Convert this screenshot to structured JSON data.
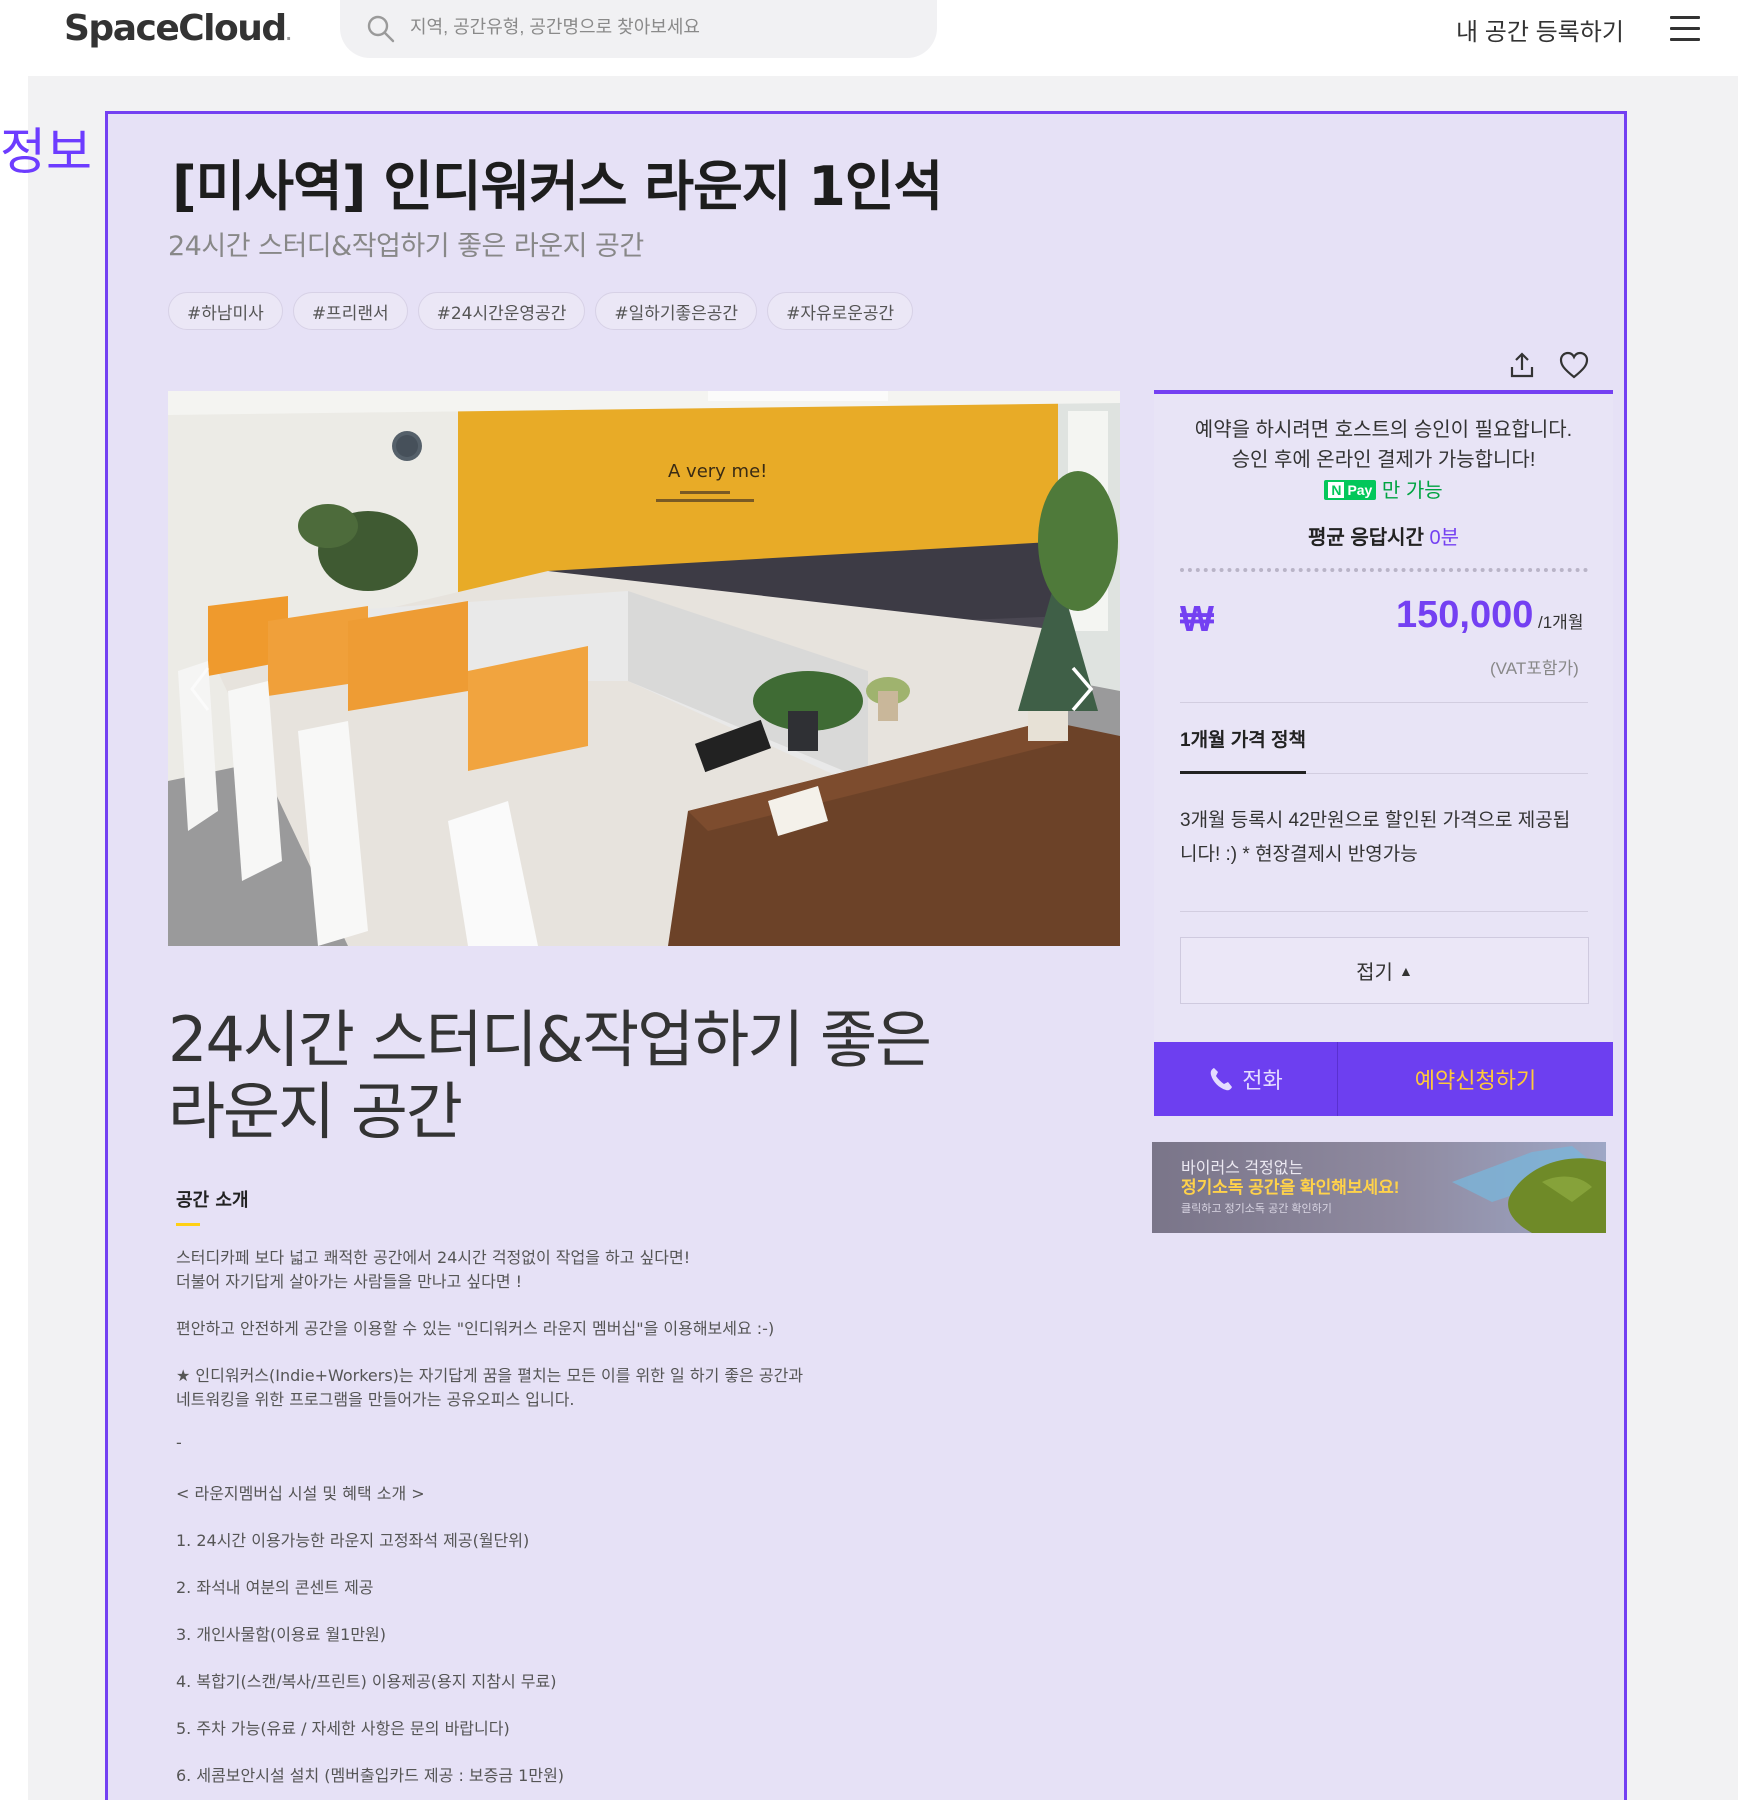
{
  "header": {
    "logo": "SpaceCloud",
    "logo_dot": ".",
    "search_placeholder": "지역, 공간유형, 공간명으로 찾아보세요",
    "register_label": "내 공간 등록하기"
  },
  "side_label": "정보",
  "space": {
    "title": "[미사역] 인디워커스 라운지 1인석",
    "subtitle": "24시간 스터디&작업하기 좋은 라운지 공간",
    "tags": [
      "#하남미사",
      "#프리랜서",
      "#24시간운영공간",
      "#일하기좋은공간",
      "#자유로운공간"
    ],
    "photo_sign_text": "A very me!",
    "heading_line1": "24시간 스터디&작업하기 좋은",
    "heading_line2": "라운지 공간"
  },
  "intro": {
    "title": "공간 소개",
    "lines": [
      "스터디카페 보다 넓고 쾌적한 공간에서 24시간 걱정없이 작업을 하고 싶다면!",
      "더불어 자기답게 살아가는 사람들을 만나고 싶다면 !",
      "편안하고 안전하게 공간을 이용할 수 있는 \"인디워커스 라운지 멤버십\"을 이용해보세요 :-)",
      "★ 인디워커스(Indie+Workers)는 자기답게 꿈을 펼치는 모든 이를 위한 일 하기 좋은 공간과",
      "네트워킹을 위한 프로그램을 만들어가는 공유오피스 입니다.",
      "-",
      "< 라운지멤버십 시설 및 혜택 소개 >",
      "1. 24시간 이용가능한 라운지 고정좌석 제공(월단위)",
      "2. 좌석내 여분의 콘센트 제공",
      "3. 개인사물함(이용료 월1만원)",
      "4. 복합기(스캔/복사/프린트) 이용제공(용지 지참시 무료)",
      "5. 주차 가능(유료 / 자세한 사항은 문의 바랍니다)",
      "6. 세콤보안시설 설치 (멤버출입카드 제공 : 보증금 1만원)"
    ]
  },
  "booking": {
    "notice_line1": "예약을 하시려면 호스트의 승인이 필요합니다.",
    "notice_line2": "승인 후에 온라인 결제가 가능합니다!",
    "npay_n": "N",
    "npay_pay": "Pay",
    "npay_suffix": "만 가능",
    "response_label": "평균 응답시간",
    "response_value": "0분",
    "currency": "₩",
    "price": "150,000",
    "period": "/1개월",
    "vat": "(VAT포함가)",
    "policy_tab": "1개월 가격 정책",
    "policy_text": "3개월 등록시 42만원으로 할인된 가격으로 제공됩니다! :) * 현장결제시 반영가능",
    "fold_label": "접기",
    "fold_arrow": "▲",
    "call_label": "전화",
    "reserve_label": "예약신청하기"
  },
  "banner": {
    "line1": "바이러스 걱정없는",
    "line2": "정기소독 공간을 확인해보세요!",
    "line3": "클릭하고 정기소독 공간 확인하기"
  },
  "colors": {
    "accent": "#7440f2",
    "highlight_bg": "#e6e1f6",
    "npay_green": "#03c75a",
    "reserve_text": "#ffc93a"
  }
}
